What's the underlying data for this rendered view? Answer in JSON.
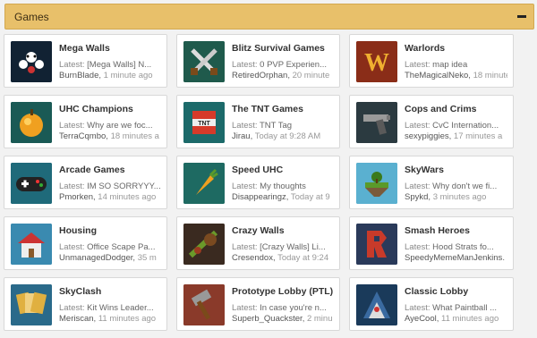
{
  "section": {
    "title": "Games",
    "collapse_icon": "minus-icon"
  },
  "cards": [
    {
      "name": "mega-walls",
      "title": "Mega Walls",
      "latest_label": "Latest:",
      "latest": "[Mega Walls] N...",
      "user": "BurnBlade",
      "time": "1 minute ago",
      "icon": "mega-walls-icon",
      "color": "#1e4a70"
    },
    {
      "name": "blitz-survival-games",
      "title": "Blitz Survival Games",
      "latest_label": "Latest:",
      "latest": "0 PVP Experien...",
      "user": "RetiredOrphan",
      "time": "20 minute",
      "icon": "crossed-swords-icon",
      "color": "#1f5a4c"
    },
    {
      "name": "warlords",
      "title": "Warlords",
      "latest_label": "Latest:",
      "latest": "map idea",
      "user": "TheMagicalNeko",
      "time": "18 minute",
      "icon": "warlords-w-icon",
      "color": "#8a2d18"
    },
    {
      "name": "uhc-champions",
      "title": "UHC Champions",
      "latest_label": "Latest:",
      "latest": "Why are we foc...",
      "user": "TerraCqmbo",
      "time": "18 minutes a",
      "icon": "golden-apple-icon",
      "color": "#1a5a55"
    },
    {
      "name": "the-tnt-games",
      "title": "The TNT Games",
      "latest_label": "Latest:",
      "latest": "TNT Tag",
      "user": "Jirau",
      "time": "Today at 9:28 AM",
      "icon": "tnt-block-icon",
      "color": "#1c6a6a"
    },
    {
      "name": "cops-and-crims",
      "title": "Cops and Crims",
      "latest_label": "Latest:",
      "latest": "CvC Internation...",
      "user": "sexypiggies",
      "time": "17 minutes a",
      "icon": "pistol-icon",
      "color": "#2b3a40"
    },
    {
      "name": "arcade-games",
      "title": "Arcade Games",
      "latest_label": "Latest:",
      "latest": "IM SO SORRYYY...",
      "user": "Pmorken",
      "time": "14 minutes ago",
      "icon": "gamepad-icon",
      "color": "#1f6a7a"
    },
    {
      "name": "speed-uhc",
      "title": "Speed UHC",
      "latest_label": "Latest:",
      "latest": "My thoughts",
      "user": "Disappearingz",
      "time": "Today at 9",
      "icon": "carrot-icon",
      "color": "#1e6a62"
    },
    {
      "name": "skywars",
      "title": "SkyWars",
      "latest_label": "Latest:",
      "latest": "Why don't we fi...",
      "user": "Spykd",
      "time": "3 minutes ago",
      "icon": "floating-island-icon",
      "color": "#2a8aa0"
    },
    {
      "name": "housing",
      "title": "Housing",
      "latest_label": "Latest:",
      "latest": "Office Scape Pa...",
      "user": "UnmanagedDodger",
      "time": "35 m",
      "icon": "house-icon",
      "color": "#3a8ab0"
    },
    {
      "name": "crazy-walls",
      "title": "Crazy Walls",
      "latest_label": "Latest:",
      "latest": "[Crazy Walls] Li...",
      "user": "Cresendox",
      "time": "Today at 9:24",
      "icon": "crazy-walls-icon",
      "color": "#3a2a20"
    },
    {
      "name": "smash-heroes",
      "title": "Smash Heroes",
      "latest_label": "Latest:",
      "latest": "Hood Strats fo...",
      "user": "SpeedyMemeManJenkins",
      "time": "",
      "icon": "smash-heroes-icon",
      "color": "#2a3a5a"
    },
    {
      "name": "skyclash",
      "title": "SkyClash",
      "latest_label": "Latest:",
      "latest": "Kit Wins Leader...",
      "user": "Meriscan",
      "time": "11 minutes ago",
      "icon": "cards-icon",
      "color": "#2a6a8a"
    },
    {
      "name": "prototype-lobby",
      "title": "Prototype Lobby (PTL)",
      "latest_label": "Latest:",
      "latest": "In case you're n...",
      "user": "Superb_Quackster",
      "time": "2 minu",
      "icon": "hammer-icon",
      "color": "#6a2a20"
    },
    {
      "name": "classic-lobby",
      "title": "Classic Lobby",
      "latest_label": "Latest:",
      "latest": "What Paintball ...",
      "user": "AyeCool",
      "time": "11 minutes ago",
      "icon": "classic-lobby-icon",
      "color": "#1a3a5a"
    }
  ]
}
